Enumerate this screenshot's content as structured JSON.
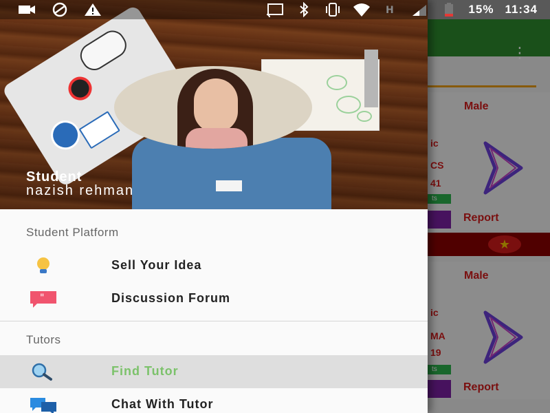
{
  "status_bar": {
    "battery_percent": "15%",
    "time": "11:34",
    "left_icons": [
      "cast-icon",
      "vpn-icon",
      "warning-icon"
    ],
    "right_icons": [
      "screencast-icon",
      "bluetooth-icon",
      "vibrate-icon",
      "wifi-icon",
      "signal-h-icon",
      "signal-icon",
      "battery-icon"
    ]
  },
  "drawer": {
    "header": {
      "role": "Student",
      "name": "nazish rehman"
    },
    "sections": [
      {
        "label": "Student Platform",
        "items": [
          {
            "label": "Sell Your Idea",
            "icon": "lightbulb-icon"
          },
          {
            "label": "Discussion Forum",
            "icon": "quote-bubble-icon"
          }
        ]
      },
      {
        "label": "Tutors",
        "items": [
          {
            "label": "Find Tutor",
            "icon": "search-icon",
            "active": true
          },
          {
            "label": "Chat With Tutor",
            "icon": "chat-icon"
          }
        ]
      }
    ]
  },
  "background_app": {
    "cards": [
      {
        "gender": "Male",
        "fragments": [
          "ic",
          "CS",
          "41"
        ],
        "chip": "ts",
        "report": "Report"
      },
      {
        "gender": "Male",
        "fragments": [
          "ic",
          "MA",
          "19"
        ],
        "chip": "ts",
        "report": "Report"
      }
    ]
  },
  "colors": {
    "appbar": "#2e8b2e",
    "active_item_text": "#7cc26b",
    "report_text": "#d21a1a",
    "accent_purple": "#7b1fa2"
  }
}
